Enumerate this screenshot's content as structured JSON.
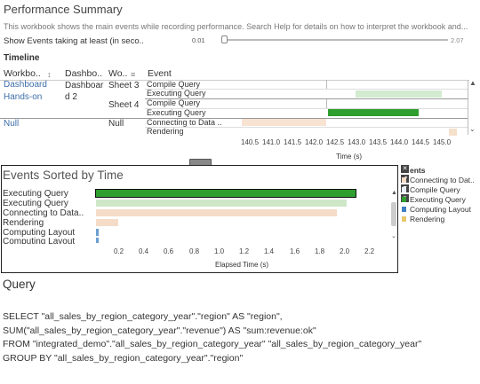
{
  "header": {
    "title": "Performance Summary",
    "subtitle": "This workbook shows the main events while recording performance. Search Help for details on how to interpret the workbook and..."
  },
  "filter": {
    "label": "Show Events taking at least (in seco..",
    "min_value": "0.01",
    "max_value": "2.07"
  },
  "timeline": {
    "section_label": "Timeline",
    "columns": {
      "workbook": "Workbo..",
      "dashboard": "Dashbo..",
      "worksheet": "Wo..",
      "event": "Event"
    },
    "rows": {
      "workbook_1": "Dashboard",
      "workbook_1b": "Hands-on",
      "dashboard_1": "Dashboar",
      "dashboard_1b": "d 2",
      "sheet_3": "Sheet 3",
      "sheet_4": "Sheet 4",
      "workbook_null": "Null",
      "dashboard_null": "Null",
      "events": [
        "Compile Query",
        "Executing Query",
        "Compile Query",
        "Executing Query",
        "Connecting to Data ..",
        "Rendering"
      ]
    },
    "axis_ticks": [
      "140.5",
      "141.0",
      "141.5",
      "142.0",
      "142.5",
      "143.0",
      "143.5",
      "144.0",
      "144.5",
      "145.0"
    ],
    "axis_title": "Time (s)"
  },
  "events_chart": {
    "title": "Events Sorted by Time",
    "labels": [
      "Executing Query",
      "Executing Query",
      "Connecting to Data..",
      "Rendering",
      "Computing Layout",
      "Computing Layout"
    ],
    "axis_ticks": [
      "0.2",
      "0.4",
      "0.6",
      "0.8",
      "1.0",
      "1.2",
      "1.4",
      "1.6",
      "1.8",
      "2.0",
      "2.2"
    ],
    "axis_title": "Elapsed Time (s)"
  },
  "legend": {
    "title": "ents",
    "items": [
      "Connecting to Dat..",
      "Compile Query",
      "Executing Query",
      "Computing Layout",
      "Rendering"
    ]
  },
  "query": {
    "title": "Query",
    "lines": [
      "SELECT \"all_sales_by_region_category_year\".\"region\" AS \"region\",",
      "  SUM(\"all_sales_by_region_category_year\".\"revenue\") AS \"sum:revenue:ok\"",
      "FROM \"integrated_demo\".\"all_sales_by_region_category_year\" \"all_sales_by_region_category_year\"",
      "GROUP BY \"all_sales_by_region_category_year\".\"region\""
    ]
  },
  "chart_data": {
    "type": "bar",
    "title": "Events Sorted by Time",
    "xlabel": "Elapsed Time (s)",
    "ylabel": "",
    "categories": [
      "Executing Query",
      "Executing Query",
      "Connecting to Data..",
      "Rendering",
      "Computing Layout",
      "Computing Layout"
    ],
    "values": [
      2.07,
      2.0,
      1.92,
      0.18,
      0.02,
      0.02
    ],
    "colors": [
      "#2e9e2e",
      "#cfe7c8",
      "#f5dcc8",
      "#f5dcc8",
      "#6aa0cf",
      "#6aa0cf"
    ],
    "xlim": [
      0,
      2.3
    ]
  }
}
